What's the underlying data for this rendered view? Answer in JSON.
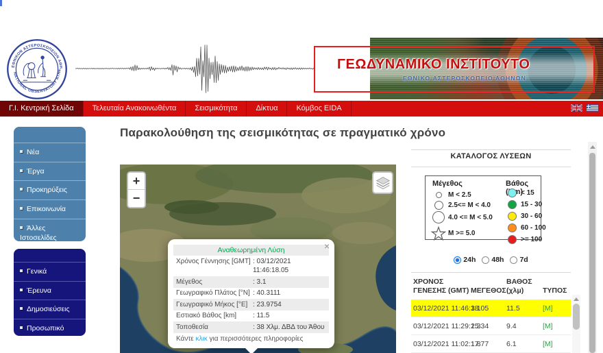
{
  "header": {
    "logo": {
      "top_text": "ΕΘΝΙΚΟΝ ΑΣΤΕΡΟΣΚΟΠΕΙΟΝ ΑΘΗΝΩΝ",
      "bottom_text": "NATIONAL OBSERVATORY ATHENS"
    },
    "banner": {
      "title": "ΓΕΩΔΥΝΑΜΙΚΟ ΙΝΣΤΙΤΟΥΤΟ",
      "subtitle": "ΕΘΝΙΚΟ ΑΣΤΕΡΟΣΚΟΠΕΙΟ ΑΘΗΝΩΝ"
    }
  },
  "nav": {
    "items": [
      {
        "label": "Γ.Ι. Κεντρική Σελίδα",
        "active": true
      },
      {
        "label": "Τελευταία Ανακοινωθέντα",
        "active": false
      },
      {
        "label": "Σεισμικότητα",
        "active": false
      },
      {
        "label": "Δίκτυα",
        "active": false
      },
      {
        "label": "Κόμβος EIDA",
        "active": false
      }
    ],
    "languages": [
      "english-flag",
      "greek-flag"
    ]
  },
  "sidebar": {
    "primary": [
      "Νέα",
      "Έργα",
      "Προκηρύξεις",
      "Επικοινωνία",
      "Άλλες Ιστοσελίδες"
    ],
    "secondary": [
      "Γενικά",
      "Έρευνα",
      "Δημοσιεύσεις",
      "Προσωπικό"
    ]
  },
  "main": {
    "title": "Παρακολούθηση της σεισμικότητας σε πραγματικό χρόνο"
  },
  "map": {
    "zoom_in": "+",
    "zoom_out": "−",
    "popup": {
      "close": "×",
      "title": "Αναθεωρημένη Λύση",
      "rows": [
        {
          "label": "Χρόνος Γέννησης [GMT]",
          "value": ": 03/12/2021 11:46:18.05"
        },
        {
          "label": "Μέγεθος",
          "value": ": 3.1"
        },
        {
          "label": "Γεωγραφικό Πλάτος [°N]",
          "value": ": 40.3111"
        },
        {
          "label": "Γεωγραφικό Μήκος [°E]",
          "value": ": 23.9754"
        },
        {
          "label": "Εστιακό Βάθος [km]",
          "value": ": 11.5"
        },
        {
          "label": "Τοποθεσία",
          "value": ": 38 Χλμ. ΔΒΔ του Άθου"
        }
      ],
      "footer_pre": "Κάντε ",
      "footer_link": "κλικ",
      "footer_post": " για περισσότερες πληροφορίες"
    }
  },
  "panel": {
    "title": "ΚΑΤΑΛΟΓΟΣ ΛΥΣΕΩΝ",
    "legend": {
      "magnitude_title": "Μέγεθος",
      "magnitude_items": [
        {
          "label": "M < 2.5",
          "symbol": "circle",
          "size": 9
        },
        {
          "label": "2.5<= M < 4.0",
          "symbol": "circle",
          "size": 13
        },
        {
          "label": "4.0 <= M < 5.0",
          "symbol": "circle",
          "size": 18
        },
        {
          "label": "M >= 5.0",
          "symbol": "star",
          "size": 22
        }
      ],
      "depth_title": "Βάθος (Km)",
      "depth_items": [
        {
          "label": "< 15",
          "color": "#7df1f1"
        },
        {
          "label": "15 - 30",
          "color": "#14a344"
        },
        {
          "label": "30 - 60",
          "color": "#ffe90c"
        },
        {
          "label": "60 - 100",
          "color": "#ff8d1d"
        },
        {
          "label": ">= 100",
          "color": "#e51d1d"
        }
      ]
    },
    "time_filters": [
      {
        "label": "24h",
        "selected": true
      },
      {
        "label": "48h",
        "selected": false
      },
      {
        "label": "7d",
        "selected": false
      }
    ],
    "table": {
      "headers": [
        "ΧΡΟΝΟΣ ΓΕΝΕΣΗΣ (GMT)",
        "ΜΕΓΕΘΟΣ",
        "ΒΑΘΟΣ (χλμ)",
        "ΤΥΠΟΣ"
      ],
      "rows": [
        {
          "time": "03/12/2021 11:46:18.05",
          "magnitude": "3.1",
          "depth": "11.5",
          "type": "[M]",
          "highlighted": true
        },
        {
          "time": "03/12/2021 11:29:15.34",
          "magnitude": "2.3",
          "depth": "9.4",
          "type": "[M]",
          "highlighted": false
        },
        {
          "time": "03/12/2021 11:02:17.77",
          "magnitude": "1.8",
          "depth": "6.1",
          "type": "[M]",
          "highlighted": false
        }
      ]
    }
  }
}
